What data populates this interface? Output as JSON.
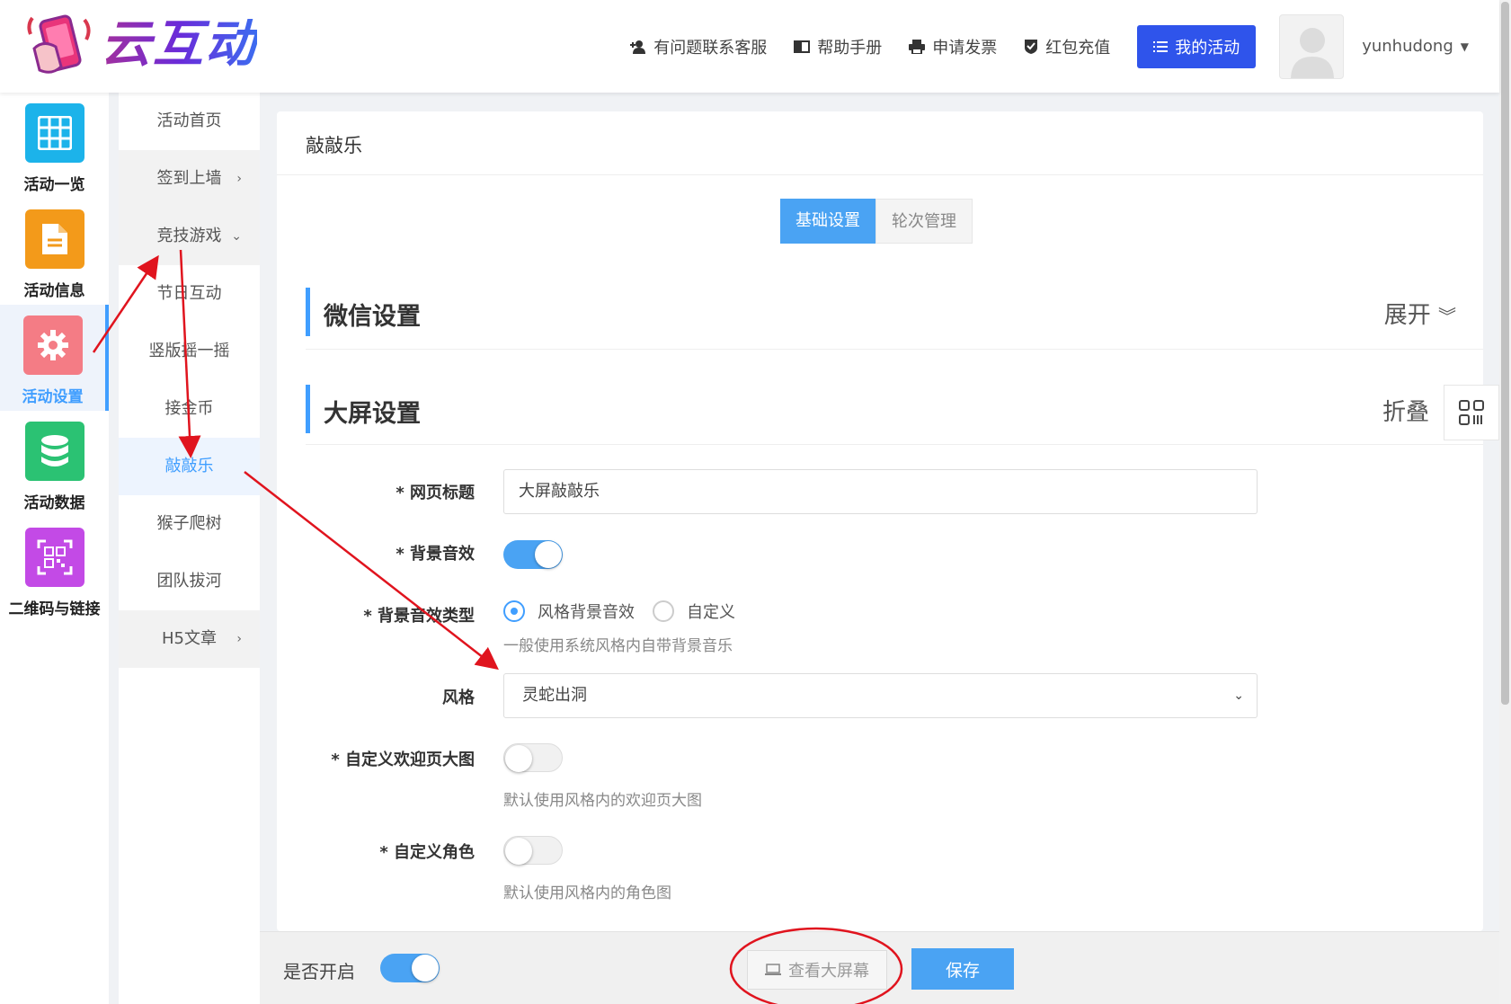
{
  "header": {
    "logo_text": "云互动",
    "links": [
      {
        "label": "有问题联系客服",
        "icon": "add-user-icon"
      },
      {
        "label": "帮助手册",
        "icon": "book-icon"
      },
      {
        "label": "申请发票",
        "icon": "printer-icon"
      },
      {
        "label": "红包充值",
        "icon": "shield-check-icon"
      }
    ],
    "my_activity": "我的活动",
    "username": "yunhudong"
  },
  "icon_sidebar": [
    {
      "label": "活动一览",
      "icon": "grid-icon",
      "color": "#1cb3ea"
    },
    {
      "label": "活动信息",
      "icon": "document-icon",
      "color": "#f39a1a"
    },
    {
      "label": "活动设置",
      "icon": "gear-icon",
      "color": "#f47c85",
      "active": true
    },
    {
      "label": "活动数据",
      "icon": "database-icon",
      "color": "#2bc273"
    },
    {
      "label": "二维码与链接",
      "icon": "qrcode-icon",
      "color": "#c34ae6"
    }
  ],
  "sub_menu": [
    {
      "label": "活动首页",
      "chevron": ""
    },
    {
      "label": "签到上墙",
      "chevron": "›"
    },
    {
      "label": "竞技游戏",
      "chevron": "⌄"
    },
    {
      "label": "节日互动",
      "chevron": ""
    },
    {
      "label": "竖版摇一摇",
      "chevron": ""
    },
    {
      "label": "接金币",
      "chevron": ""
    },
    {
      "label": "敲敲乐",
      "chevron": ""
    },
    {
      "label": "猴子爬树",
      "chevron": ""
    },
    {
      "label": "团队拔河",
      "chevron": ""
    },
    {
      "label": "H5文章",
      "chevron": "›"
    }
  ],
  "main": {
    "title": "敲敲乐",
    "tabs": [
      "基础设置",
      "轮次管理"
    ],
    "wechat_section": {
      "title": "微信设置",
      "toggle": "展开"
    },
    "screen_section": {
      "title": "大屏设置",
      "toggle": "折叠"
    },
    "fields": {
      "page_title_label": "* 网页标题",
      "page_title_value": "大屏敲敲乐",
      "bg_sound_label": "* 背景音效",
      "bg_sound_type_label": "* 背景音效类型",
      "radio_style": "风格背景音效",
      "radio_custom": "自定义",
      "bg_sound_hint": "一般使用系统风格内自带背景音乐",
      "style_label": "风格",
      "style_value": "灵蛇出洞",
      "custom_welcome_label": "* 自定义欢迎页大图",
      "custom_welcome_hint": "默认使用风格内的欢迎页大图",
      "custom_role_label": "* 自定义角色",
      "custom_role_hint": "默认使用风格内的角色图"
    }
  },
  "footer": {
    "enable_label": "是否开启",
    "view_screen": "查看大屏幕",
    "save": "保存"
  },
  "colors": {
    "accent": "#409eff",
    "annotation": "#e0141e"
  }
}
